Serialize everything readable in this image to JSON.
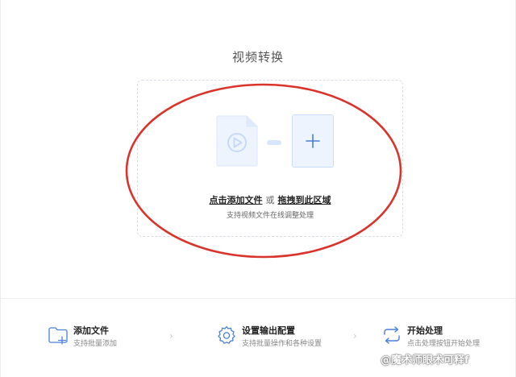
{
  "title": "视频转换",
  "dropzone": {
    "add_file_link": "点击添加文件",
    "or_text": "或",
    "drag_link": "拖拽到此区域",
    "hint": "支持视频文件在线调整处理"
  },
  "steps": [
    {
      "title": "添加文件",
      "desc": "支持批量添加",
      "icon": "folder-add-icon"
    },
    {
      "title": "设置输出配置",
      "desc": "支持批量操作和各种设置",
      "icon": "settings-gear-icon"
    },
    {
      "title": "开始处理",
      "desc": "点击处理按钮开始处理",
      "icon": "convert-arrows-icon"
    }
  ],
  "watermark": "@魔术师眼术可释f",
  "colors": {
    "accent": "#4a7fd6",
    "annotation": "#d9342b",
    "accent_light": "#eef4fe"
  }
}
